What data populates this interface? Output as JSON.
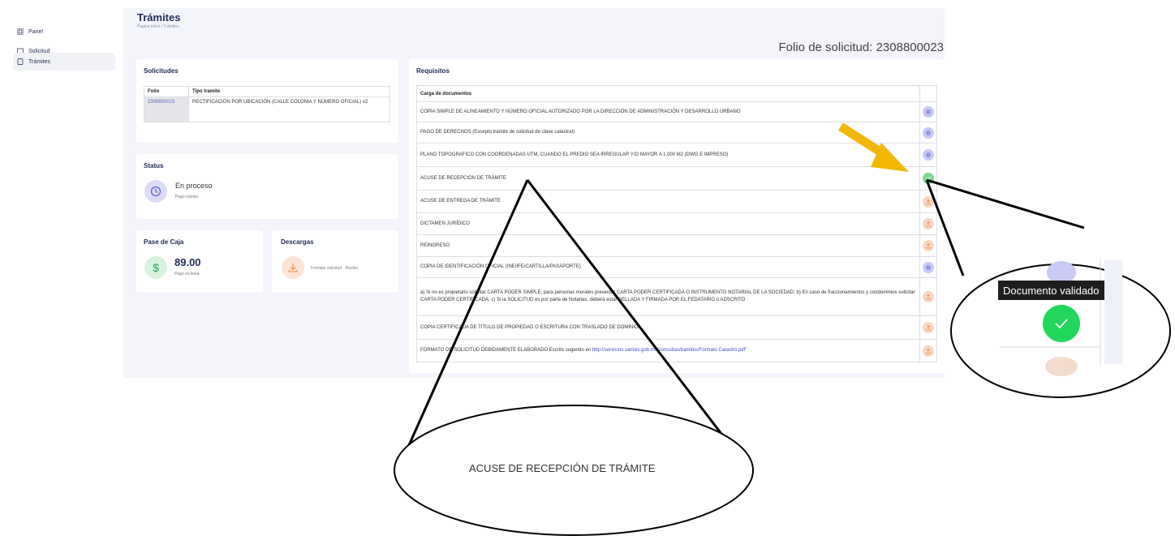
{
  "sidebar": {
    "items": [
      {
        "label": "Panel",
        "icon": "grid-icon"
      },
      {
        "label": "Solicitud",
        "icon": "folder-icon"
      },
      {
        "label": "Trámites",
        "icon": "document-icon"
      }
    ]
  },
  "header": {
    "title": "Trámites",
    "breadcrumb": "Pagina inicio  /  Trámites",
    "folio_label": "Folio de solicitud: 2308800023"
  },
  "solicitudes": {
    "title": "Solicitudes",
    "columns": [
      "Folio",
      "Tipo tramite"
    ],
    "rows": [
      {
        "folio": "2308800023",
        "tipo": "RECTIFICACIÓN POR UBICACIÓN (CALLE COLONIA Y NÚMERO OFICIAL) v2"
      }
    ]
  },
  "status": {
    "title": "Status",
    "value": "En proceso",
    "sub": "Pago trámite"
  },
  "pase_caja": {
    "title": "Pase de Caja",
    "amount": "89.00",
    "sub": "Pago en linea"
  },
  "descargas": {
    "title": "Descargas",
    "link1": "Formato solicitud",
    "link2": "Recibo"
  },
  "requisitos": {
    "title": "Requisitos",
    "header": "Carga de documentos",
    "rows": [
      {
        "text": "COPIA SIMPLE DE ALINEAMIENTO Y NÚMERO OFICIAL AUTORIZADO POR LA DIRECCIÓN DE ADMINISTRACIÓN Y DESARROLLO URBANO",
        "status": "gear"
      },
      {
        "text": "PAGO DE DERECHOS (Excepto trámite de solicitud de clave catastral)",
        "status": "gear"
      },
      {
        "text": "PLANO TOPOGRAFICO CON COORDENADAS UTM, CUANDO EL PREDIO SEA IRREGULAR Y/O MAYOR A 1,000 M2 (DWG E IMPRESO)",
        "status": "gear"
      },
      {
        "text": "ACUSE DE RECEPCIÓN DE TRÁMITE",
        "status": "ok"
      },
      {
        "text": "ACUSE DE ENTREGA DE TRÁMITE",
        "status": "upload"
      },
      {
        "text": "DICTAMEN JURÍDICO",
        "status": "upload"
      },
      {
        "text": "REINGRESO",
        "status": "upload"
      },
      {
        "text": "COPIA DE IDENTIFICACIÓN OFICIAL (INE/IFE/CARTILLA/PASAPORTE)",
        "status": "gear"
      },
      {
        "text": "a) Si no es propietario solicitar CARTA PODER SIMPLE, para personas morales presentar CARTA PODER CERTIFICADA O INSTRUMENTO NOTARIAL DE LA SOCIEDAD; b) En caso de fraccionamientos y condominios solicitar CARTA PODER CERTIFICADA; c) Si la SOLICITUD es por parte de Notarias, deberá estar SELLADA Y FIRMADA POR EL FEDATARIO ó ADSCRITO",
        "status": "upload"
      },
      {
        "text": "COPIA CERTIFICADA DE TITULO DE PROPIEDAD O ESCRITURA CON TRASLADO DE DOMINIO",
        "status": "upload"
      }
    ],
    "last_row": {
      "text": "FORMATO DE SOLICITUD DEBIDAMENTE ELABORADO Escrito sugerido en ",
      "link": "http://servicios.sanluis.gob.mx/consultas/tramites/Formato Catastro.pdf\"",
      "status": "upload"
    }
  },
  "callouts": {
    "zoom_text": "ACUSE DE RECEPCIÓN DE TRÁMITE",
    "tooltip": "Documento validado"
  },
  "colors": {
    "accent": "#5b5fc7",
    "success": "#2ed162",
    "arrow": "#f2b705",
    "upload": "#f8d7c4",
    "gear": "#c8c9f4"
  }
}
